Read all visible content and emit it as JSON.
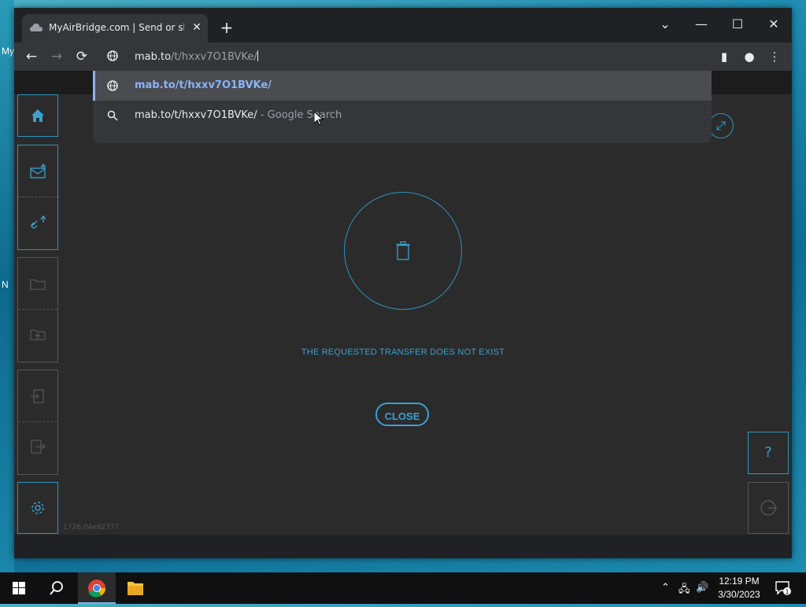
{
  "desktop": {
    "side_labels": [
      "My",
      "N"
    ]
  },
  "browser": {
    "tab_title": "MyAirBridge.com | Send or share",
    "new_tab_label": "+",
    "controls": {
      "list_tabs": "⌄",
      "minimize": "—",
      "maximize": "☐",
      "close": "✕"
    },
    "address": {
      "host": "mab.to",
      "path": "/t/hxxv7O1BVKe/"
    },
    "suggestions": [
      {
        "icon": "globe-icon",
        "text": "mab.to/t/hxxv7O1BVKe/",
        "suffix": ""
      },
      {
        "icon": "search-icon",
        "text": "mab.to/t/hxxv7O1BVKe/",
        "suffix": " - Google Search"
      }
    ]
  },
  "page": {
    "message": "THE REQUESTED TRANSFER DOES NOT EXIST",
    "close_label": "CLOSE",
    "help_label": "?",
    "version": "1726.04e82777",
    "accent": "#2e95bd"
  },
  "taskbar": {
    "time": "12:19 PM",
    "date": "3/30/2023",
    "notification_count": "1"
  }
}
